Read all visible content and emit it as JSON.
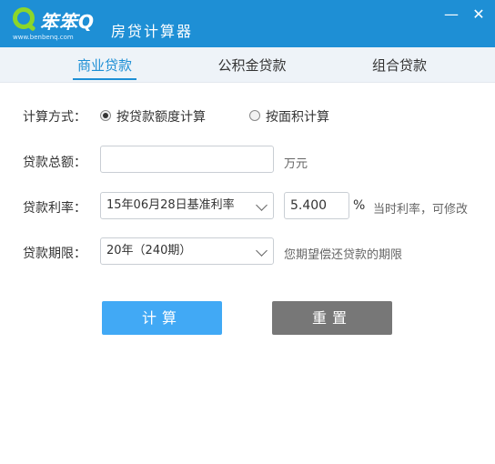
{
  "titlebar": {
    "logo_text": "笨笨Q",
    "logo_sub": "www.benbenq.com",
    "app_title": "房贷计算器",
    "minimize": "—",
    "close": "✕"
  },
  "tabs": [
    "商业贷款",
    "公积金贷款",
    "组合贷款"
  ],
  "form": {
    "calc_method_label": "计算方式：",
    "option_amount": "按贷款额度计算",
    "option_area": "按面积计算",
    "loan_total_label": "贷款总额：",
    "loan_total_value": "",
    "loan_total_unit": "万元",
    "rate_label": "贷款利率：",
    "rate_select": "15年06月28日基准利率",
    "rate_value": "5.400",
    "rate_unit": "%",
    "rate_hint": "当时利率，可修改",
    "term_label": "贷款期限：",
    "term_select": "20年（240期）",
    "term_hint": "您期望偿还贷款的期限"
  },
  "buttons": {
    "calculate": "计算",
    "reset": "重置"
  },
  "colors": {
    "accent": "#1e8fd5",
    "calc_button": "#41a9f5",
    "reset_button": "#777777"
  }
}
